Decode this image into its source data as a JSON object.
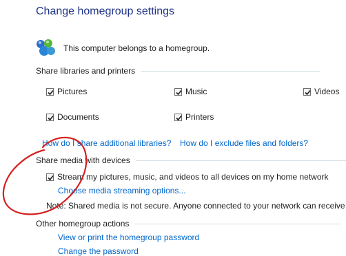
{
  "page": {
    "title": "Change homegroup settings",
    "membership_text": "This computer belongs to a homegroup."
  },
  "share_libraries": {
    "heading": "Share libraries and printers",
    "items": [
      {
        "label": "Pictures",
        "checked": true
      },
      {
        "label": "Music",
        "checked": true
      },
      {
        "label": "Videos",
        "checked": true
      },
      {
        "label": "Documents",
        "checked": true
      },
      {
        "label": "Printers",
        "checked": true
      }
    ],
    "links": [
      "How do I share additional libraries?",
      "How do I exclude files and folders?"
    ]
  },
  "share_media": {
    "heading": "Share media with devices",
    "stream_label": "Stream my pictures, music, and videos to all devices on my home network",
    "stream_checked": true,
    "options_link": "Choose media streaming options...",
    "note": "Note: Shared media is not secure. Anyone connected to your network can receive y"
  },
  "other_actions": {
    "heading": "Other homegroup actions",
    "links": [
      "View or print the homegroup password",
      "Change the password"
    ]
  },
  "colors": {
    "title": "#1e3287",
    "link": "#0066cc",
    "annotation": "#d42020"
  }
}
